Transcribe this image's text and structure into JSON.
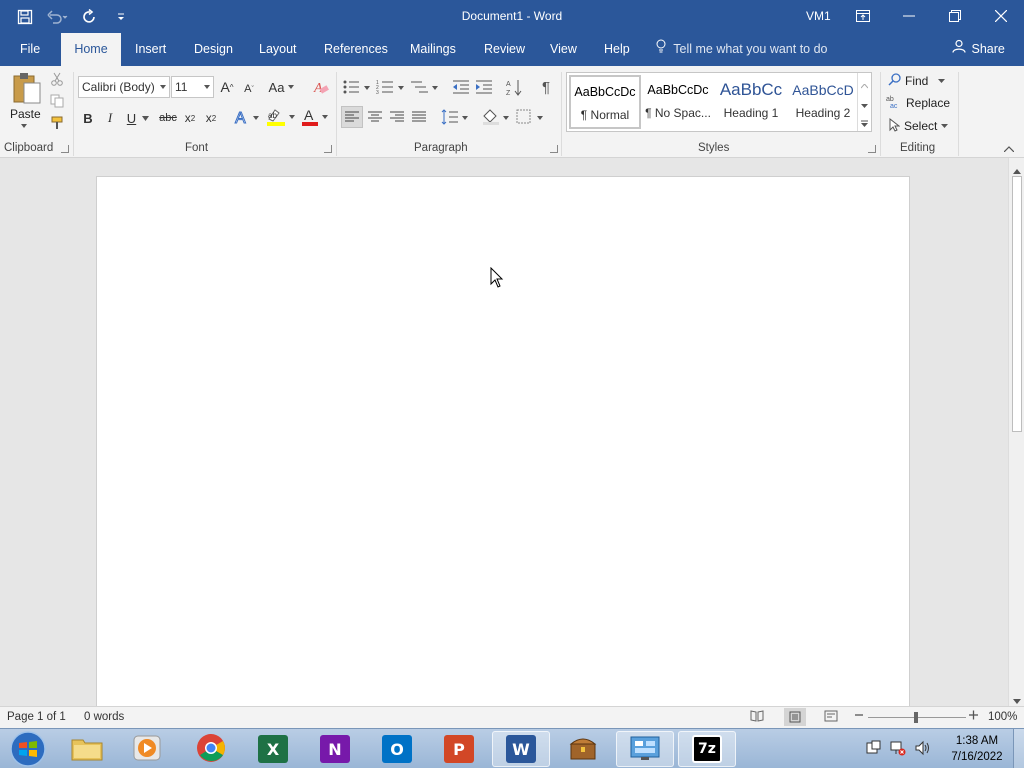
{
  "window": {
    "title": "Document1  -  Word",
    "user": "VM1",
    "colors": {
      "brand": "#2b579a",
      "ribbon_bg": "#f3f3f3",
      "doc_bg": "#e6e6e6"
    }
  },
  "tabs": [
    "File",
    "Home",
    "Insert",
    "Design",
    "Layout",
    "References",
    "Mailings",
    "Review",
    "View",
    "Help"
  ],
  "active_tab": "Home",
  "tell_me": "Tell me what you want to do",
  "share": "Share",
  "clipboard": {
    "paste": "Paste",
    "label": "Clipboard"
  },
  "font": {
    "name": "Calibri (Body)",
    "size": "11",
    "case": "Aa",
    "label": "Font"
  },
  "paragraph": {
    "label": "Paragraph"
  },
  "styles": {
    "label": "Styles",
    "items": [
      {
        "preview": "AaBbCcDc",
        "name": "¶ Normal"
      },
      {
        "preview": "AaBbCcDc",
        "name": "¶ No Spac..."
      },
      {
        "preview": "AaBbCc",
        "name": "Heading 1"
      },
      {
        "preview": "AaBbCcD",
        "name": "Heading 2"
      }
    ]
  },
  "editing": {
    "find": "Find",
    "replace": "Replace",
    "select": "Select",
    "label": "Editing"
  },
  "status": {
    "page": "Page 1 of 1",
    "words": "0 words",
    "zoom": "100%"
  },
  "taskbar": {
    "time": "1:38 AM",
    "date": "7/16/2022"
  }
}
